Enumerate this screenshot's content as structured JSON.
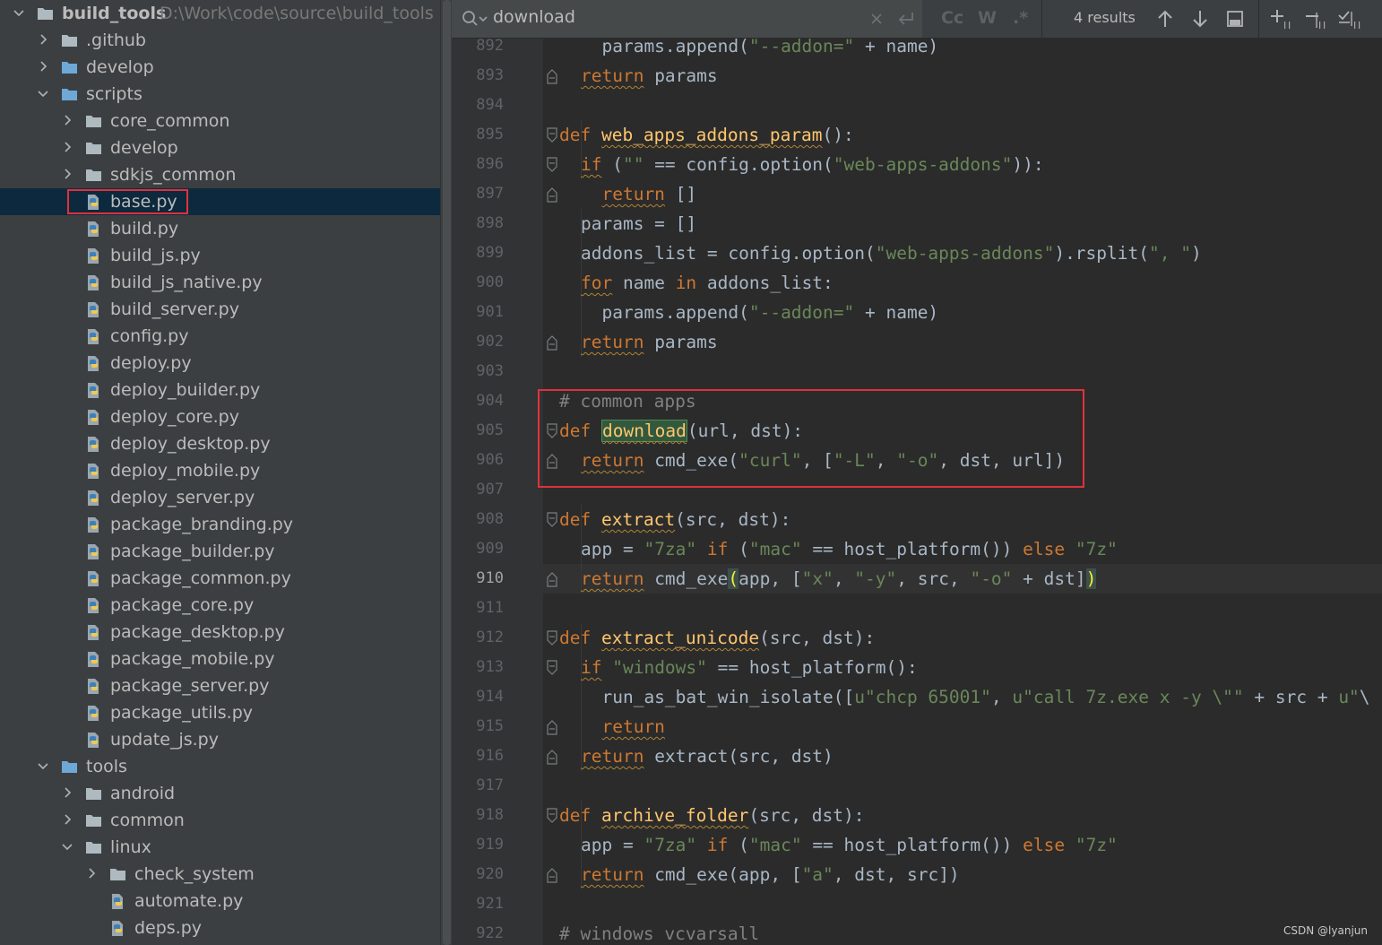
{
  "project": {
    "root_name": "build_tools",
    "root_path": "D:\\Work\\code\\source\\build_tools",
    "items": [
      {
        "label": "build_tools",
        "type": "root"
      },
      {
        "label": ".github",
        "type": "folder",
        "state": "collapsed"
      },
      {
        "label": "develop",
        "type": "folder",
        "state": "collapsed"
      },
      {
        "label": "scripts",
        "type": "folder",
        "state": "expanded"
      },
      {
        "label": "core_common",
        "type": "folder",
        "state": "collapsed"
      },
      {
        "label": "develop",
        "type": "folder",
        "state": "collapsed"
      },
      {
        "label": "sdkjs_common",
        "type": "folder",
        "state": "collapsed"
      },
      {
        "label": "base.py",
        "type": "python",
        "selected": true
      },
      {
        "label": "build.py",
        "type": "python"
      },
      {
        "label": "build_js.py",
        "type": "python"
      },
      {
        "label": "build_js_native.py",
        "type": "python"
      },
      {
        "label": "build_server.py",
        "type": "python"
      },
      {
        "label": "config.py",
        "type": "python"
      },
      {
        "label": "deploy.py",
        "type": "python"
      },
      {
        "label": "deploy_builder.py",
        "type": "python"
      },
      {
        "label": "deploy_core.py",
        "type": "python"
      },
      {
        "label": "deploy_desktop.py",
        "type": "python"
      },
      {
        "label": "deploy_mobile.py",
        "type": "python"
      },
      {
        "label": "deploy_server.py",
        "type": "python"
      },
      {
        "label": "package_branding.py",
        "type": "python"
      },
      {
        "label": "package_builder.py",
        "type": "python"
      },
      {
        "label": "package_common.py",
        "type": "python"
      },
      {
        "label": "package_core.py",
        "type": "python"
      },
      {
        "label": "package_desktop.py",
        "type": "python"
      },
      {
        "label": "package_mobile.py",
        "type": "python"
      },
      {
        "label": "package_server.py",
        "type": "python"
      },
      {
        "label": "package_utils.py",
        "type": "python"
      },
      {
        "label": "update_js.py",
        "type": "python"
      },
      {
        "label": "tools",
        "type": "folder",
        "state": "expanded"
      },
      {
        "label": "android",
        "type": "folder",
        "state": "collapsed"
      },
      {
        "label": "common",
        "type": "folder",
        "state": "collapsed"
      },
      {
        "label": "linux",
        "type": "folder",
        "state": "expanded"
      },
      {
        "label": "check_system",
        "type": "folder",
        "state": "collapsed"
      },
      {
        "label": "automate.py",
        "type": "python"
      },
      {
        "label": "deps.py",
        "type": "python"
      }
    ]
  },
  "find": {
    "query": "download",
    "results": "4 results",
    "match_case_label": "Cc",
    "words_label": "W",
    "regex_label": ".*"
  },
  "editor": {
    "current_line": 910,
    "lines": [
      {
        "n": "892",
        "html": ""
      },
      {
        "n": "893",
        "html": ""
      },
      {
        "n": "894",
        "html": ""
      },
      {
        "n": "895",
        "html": ""
      },
      {
        "n": "896",
        "html": ""
      },
      {
        "n": "897",
        "html": ""
      },
      {
        "n": "898",
        "html": ""
      },
      {
        "n": "899",
        "html": ""
      },
      {
        "n": "900",
        "html": ""
      },
      {
        "n": "901",
        "html": ""
      },
      {
        "n": "902",
        "html": ""
      },
      {
        "n": "903",
        "html": ""
      },
      {
        "n": "904",
        "html": ""
      },
      {
        "n": "905",
        "html": ""
      },
      {
        "n": "906",
        "html": ""
      },
      {
        "n": "907",
        "html": ""
      },
      {
        "n": "908",
        "html": ""
      },
      {
        "n": "909",
        "html": ""
      },
      {
        "n": "910",
        "html": ""
      },
      {
        "n": "911",
        "html": ""
      },
      {
        "n": "912",
        "html": ""
      },
      {
        "n": "913",
        "html": ""
      },
      {
        "n": "914",
        "html": ""
      },
      {
        "n": "915",
        "html": ""
      },
      {
        "n": "916",
        "html": ""
      },
      {
        "n": "917",
        "html": ""
      },
      {
        "n": "918",
        "html": ""
      },
      {
        "n": "919",
        "html": ""
      },
      {
        "n": "920",
        "html": ""
      },
      {
        "n": "921",
        "html": ""
      },
      {
        "n": "922",
        "html": ""
      }
    ],
    "code": [
      "  params.append(\"--addon=\" + name)",
      "return params",
      "",
      "def web_apps_addons_param():",
      "if (\"\" == config.option(\"web-apps-addons\")):",
      "  return []",
      "params = []",
      "addons_list = config.option(\"web-apps-addons\").rsplit(\", \")",
      "for name in addons_list:",
      "  params.append(\"--addon=\" + name)",
      "return params",
      "",
      "# common apps",
      "def download(url, dst):",
      "return cmd_exe(\"curl\", [\"-L\", \"-o\", dst, url])",
      "",
      "def extract(src, dst):",
      "app = \"7za\" if (\"mac\" == host_platform()) else \"7z\"",
      "return cmd_exe(app, [\"x\", \"-y\", src, \"-o\" + dst])",
      "",
      "def extract_unicode(src, dst):",
      "if \"windows\" == host_platform():",
      "  run_as_bat_win_isolate([u\"chcp 65001\", u\"call 7z.exe x -y \\\"\" + src + u\"\\",
      "  return",
      "return extract(src, dst)",
      "",
      "def archive_folder(src, dst):",
      "app = \"7za\" if (\"mac\" == host_platform()) else \"7z\"",
      "return cmd_exe(app, [\"a\", dst, src])",
      "",
      "# windows vcvarsall"
    ]
  },
  "watermark": "CSDN @lyanjun"
}
